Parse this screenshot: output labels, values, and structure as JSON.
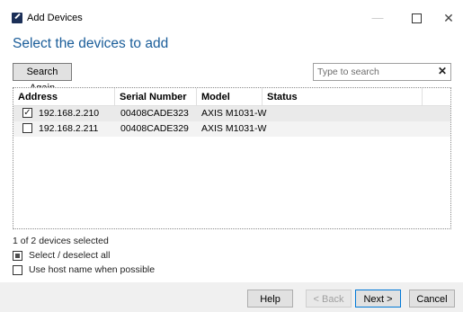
{
  "window": {
    "title": "Add Devices",
    "minimize": "—",
    "close": "✕"
  },
  "heading": "Select the devices to add",
  "toolbar": {
    "search_again": "Search Again",
    "search_placeholder": "Type to search",
    "clear": "✕"
  },
  "table": {
    "columns": [
      "Address",
      "Serial Number",
      "Model",
      "Status"
    ],
    "rows": [
      {
        "checked": true,
        "address": "192.168.2.210",
        "serial": "00408CADE323",
        "model": "AXIS M1031-W",
        "status": ""
      },
      {
        "checked": false,
        "address": "192.168.2.211",
        "serial": "00408CADE329",
        "model": "AXIS M1031-W",
        "status": ""
      }
    ]
  },
  "selection_status": "1 of 2 devices selected",
  "options": {
    "select_all": "Select / deselect all",
    "use_host_name": "Use host name when possible"
  },
  "footer": {
    "help": "Help",
    "back": "< Back",
    "next": "Next >",
    "cancel": "Cancel"
  },
  "colors": {
    "heading": "#1a5d99",
    "accent": "#0078d7"
  }
}
